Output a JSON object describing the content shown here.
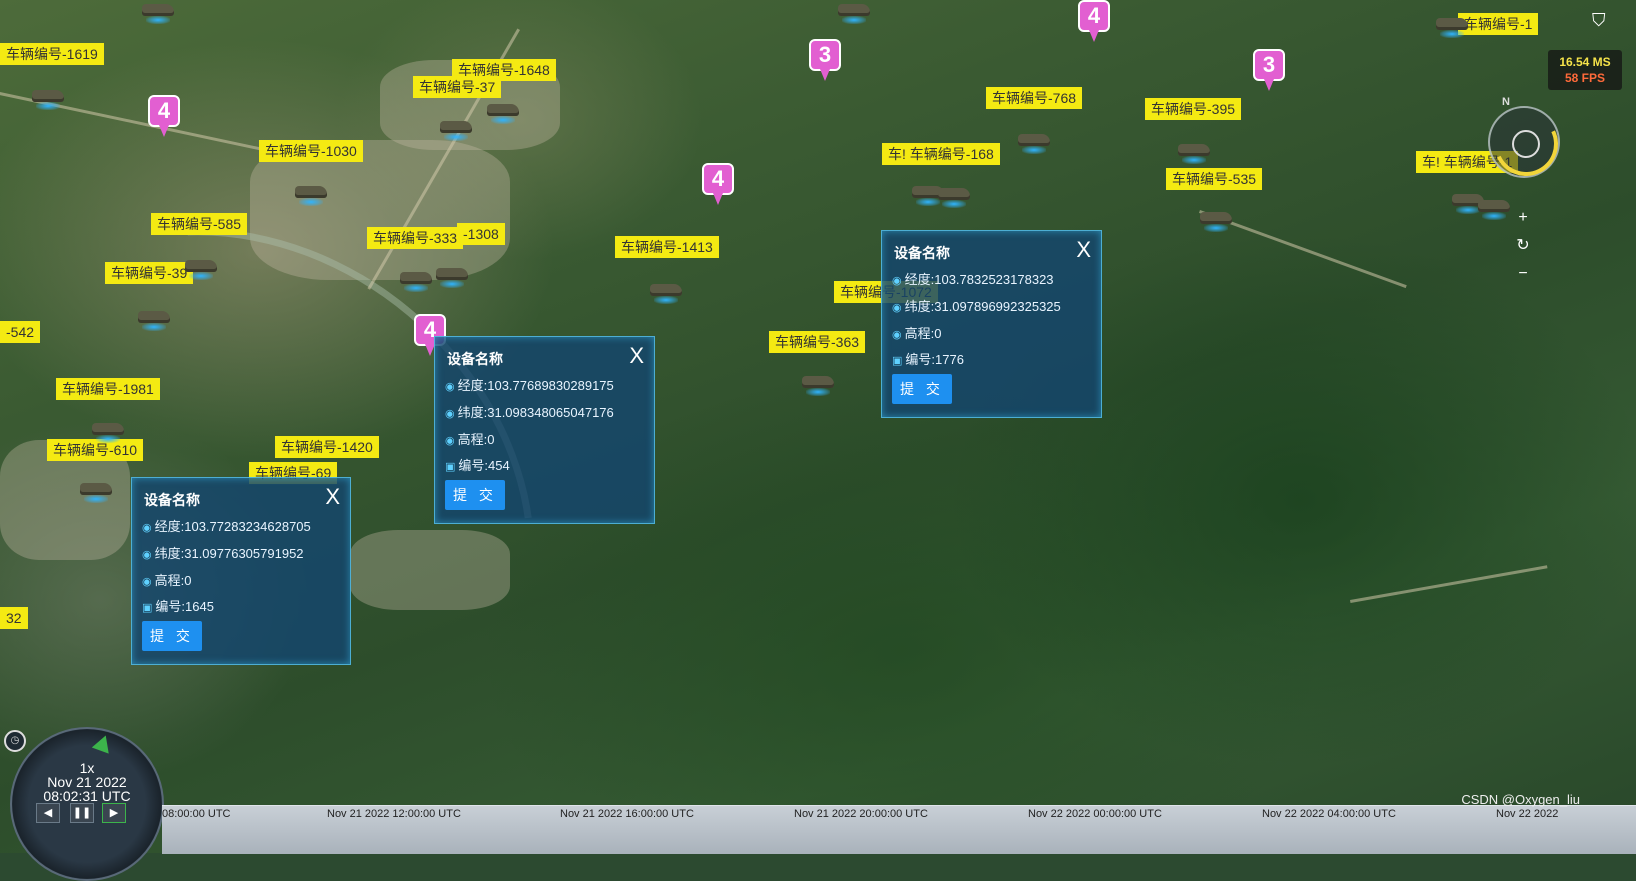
{
  "vehicle_labels": [
    {
      "text": "车辆编号-1619"
    },
    {
      "text": "车辆编号-1648"
    },
    {
      "text": "车辆编号-37"
    },
    {
      "text": "车辆编号-1030"
    },
    {
      "text": "车辆编号-585"
    },
    {
      "text": "车辆编号-333"
    },
    {
      "text": "-1308"
    },
    {
      "text": "车辆编号-39"
    },
    {
      "text": "-542"
    },
    {
      "text": "车辆编号-1981"
    },
    {
      "text": "车辆编号-610"
    },
    {
      "text": "车辆编号-1420"
    },
    {
      "text": "车辆编号-69"
    },
    {
      "text": "32"
    },
    {
      "text": "车辆编号-1413"
    },
    {
      "text": "车辆编号-363"
    },
    {
      "text": "车辆编号-1072"
    },
    {
      "text": "车辆编号-768"
    },
    {
      "text": "车! 车辆编号-168"
    },
    {
      "text": "车辆编号-395"
    },
    {
      "text": "车辆编号-535"
    },
    {
      "text": "车辆编号-1"
    },
    {
      "text": "车! 车辆编号-1"
    }
  ],
  "cluster_pins": [
    "4",
    "4",
    "4",
    "4",
    "3",
    "3"
  ],
  "popups": [
    {
      "title": "设备名称",
      "close": "X",
      "lng_label": "经度:",
      "lng": "103.77283234628705",
      "lat_label": "纬度:",
      "lat": "31.09776305791952",
      "alt_label": "高程:",
      "alt": "0",
      "id_label": "编号:",
      "id": "1645",
      "submit": "提 交"
    },
    {
      "title": "设备名称",
      "close": "X",
      "lng_label": "经度:",
      "lng": "103.77689830289175",
      "lat_label": "纬度:",
      "lat": "31.098348065047176",
      "alt_label": "高程:",
      "alt": "0",
      "id_label": "编号:",
      "id": "454",
      "submit": "提 交"
    },
    {
      "title": "设备名称",
      "close": "X",
      "lng_label": "经度:",
      "lng": "103.7832523178323",
      "lat_label": "纬度:",
      "lat": "31.097896992325325",
      "alt_label": "高程:",
      "alt": "0",
      "id_label": "编号:",
      "id": "1776",
      "submit": "提 交"
    }
  ],
  "fps": {
    "ms": "16.54 MS",
    "fps": "58 FPS"
  },
  "compass_north": "N",
  "zoom": {
    "in": "+",
    "reset": "↻",
    "out": "−"
  },
  "clock": {
    "speed": "1x",
    "date": "Nov 21 2022",
    "time": "08:02:31 UTC"
  },
  "timeline_ticks": [
    "08:00:00 UTC",
    "Nov 21 2022 12:00:00 UTC",
    "Nov 21 2022 16:00:00 UTC",
    "Nov 21 2022 20:00:00 UTC",
    "Nov 22 2022 00:00:00 UTC",
    "Nov 22 2022 04:00:00 UTC",
    "Nov 22 2022"
  ],
  "watermark": "CSDN @Oxygen_liu",
  "colors": {
    "label_bg": "#f4ea12",
    "pin": "#e25fd1",
    "button": "#1e90f0",
    "popup_border": "#5ac8f0"
  }
}
